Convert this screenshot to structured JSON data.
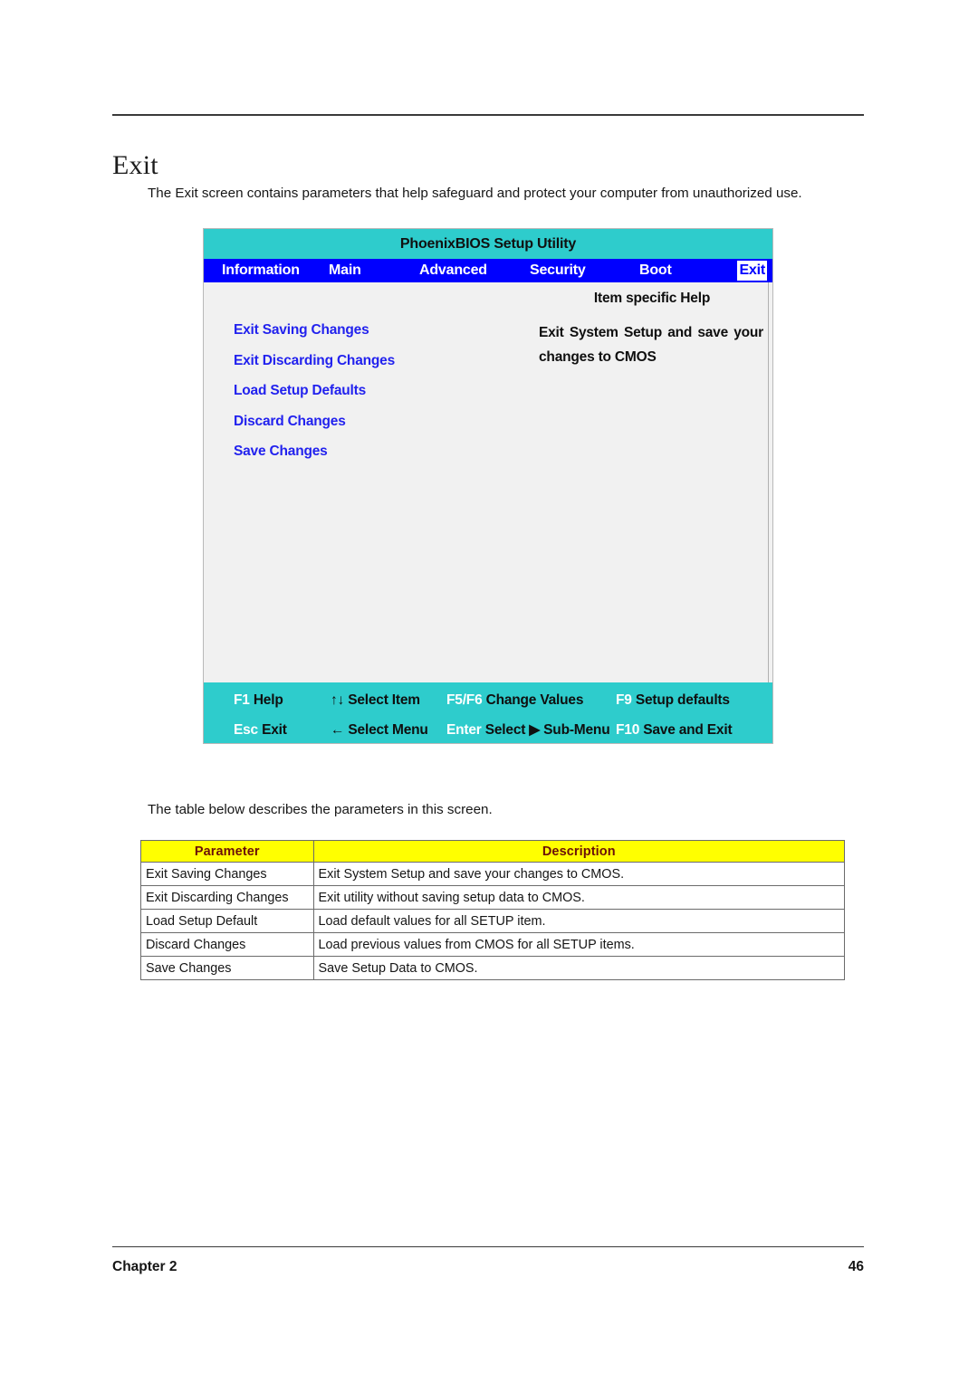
{
  "document": {
    "title": "Exit",
    "intro_paragraph": "The Exit screen contains parameters that help safeguard and protect your computer from unauthorized use.",
    "mid_paragraph": "The table below describes the parameters in this screen.",
    "footer": {
      "chapter": "Chapter 2",
      "page_number": "46"
    }
  },
  "bios": {
    "title": "PhoenixBIOS Setup Utility",
    "colors": {
      "title_bar": "#2ECCCC",
      "menu_bar": "#0000FF",
      "body": "#F1F1F1",
      "option_text": "#2222EE",
      "selected_tab_bg": "#FFFFFF",
      "selected_tab_text": "#0000FF"
    },
    "menu": [
      {
        "label": "Information",
        "selected": false
      },
      {
        "label": "Main",
        "selected": false
      },
      {
        "label": "Advanced",
        "selected": false
      },
      {
        "label": "Security",
        "selected": false
      },
      {
        "label": "Boot",
        "selected": false
      },
      {
        "label": "Exit",
        "selected": true
      }
    ],
    "options": [
      "Exit Saving Changes",
      "Exit Discarding Changes",
      "Load Setup Defaults",
      "Discard Changes",
      "Save Changes"
    ],
    "help": {
      "title": "Item specific Help",
      "text": "Exit System Setup and save your changes to CMOS"
    },
    "function_keys": {
      "row1": [
        {
          "key": "F1",
          "glyph": "",
          "desc": "Help"
        },
        {
          "key": "",
          "glyph": "↑↓",
          "desc": "Select Item"
        },
        {
          "key": "F5/F6",
          "glyph": "",
          "desc": "Change Values"
        },
        {
          "key": "F9",
          "glyph": "",
          "desc": "Setup defaults"
        }
      ],
      "row2": [
        {
          "key": "Esc",
          "glyph": "",
          "desc": "Exit"
        },
        {
          "key": "",
          "glyph": "←",
          "desc": "Select Menu"
        },
        {
          "key": "Enter",
          "glyph": "▶",
          "desc_before": "Select",
          "desc": "Sub-Menu"
        },
        {
          "key": "F10",
          "glyph": "",
          "desc": "Save and Exit"
        }
      ]
    }
  },
  "table": {
    "headers": {
      "parameter": "Parameter",
      "description": "Description"
    },
    "header_bg": "#FFFF00",
    "header_text_color": "#6B1008",
    "rows": [
      {
        "parameter": "Exit Saving Changes",
        "description": "Exit System Setup and save your changes to CMOS."
      },
      {
        "parameter": "Exit Discarding Changes",
        "description": "Exit utility without saving setup data to CMOS."
      },
      {
        "parameter": "Load Setup Default",
        "description": "Load default values for all SETUP item."
      },
      {
        "parameter": "Discard Changes",
        "description": "Load previous values from CMOS for all SETUP items."
      },
      {
        "parameter": "Save Changes",
        "description": "Save Setup Data to CMOS."
      }
    ]
  }
}
